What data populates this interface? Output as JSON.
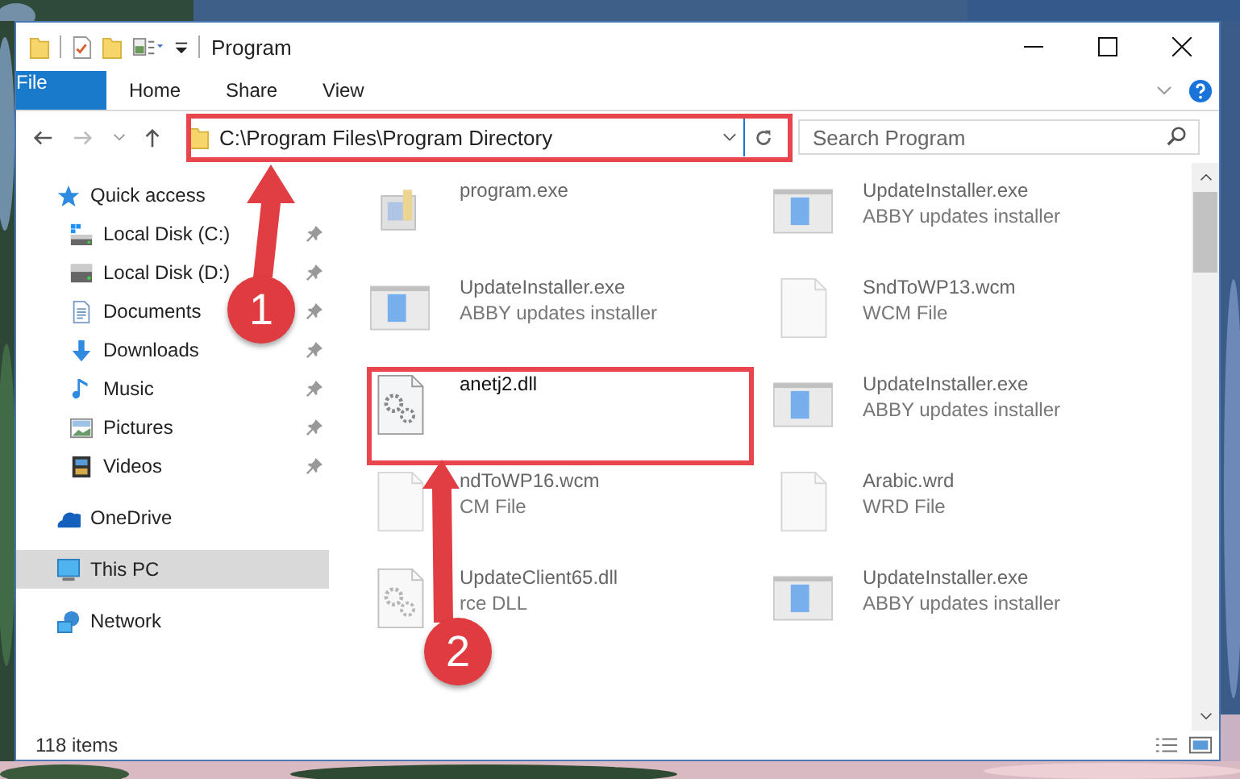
{
  "window": {
    "title": "Program"
  },
  "ribbon": {
    "tabs": [
      {
        "label": "File",
        "kind": "file",
        "selected": false
      },
      {
        "label": "Home",
        "kind": "tab",
        "selected": false
      },
      {
        "label": "Share",
        "kind": "tab",
        "selected": false
      },
      {
        "label": "View",
        "kind": "tab",
        "selected": false
      }
    ]
  },
  "address_bar": {
    "path": "C:\\Program Files\\Program Directory"
  },
  "search": {
    "placeholder": "Search Program"
  },
  "sidebar": {
    "items": [
      {
        "label": "Quick access",
        "kind": "star",
        "selected": false,
        "children": [
          {
            "label": "Local Disk (C:)",
            "kind": "system-drive",
            "pinned": true,
            "selected": false
          },
          {
            "label": "Local Disk (D:)",
            "kind": "drive",
            "pinned": true,
            "selected": false
          },
          {
            "label": "Documents",
            "kind": "documents",
            "pinned": true,
            "selected": false
          },
          {
            "label": "Downloads",
            "kind": "downloads",
            "pinned": true,
            "selected": false
          },
          {
            "label": "Music",
            "kind": "music",
            "pinned": true,
            "selected": false
          },
          {
            "label": "Pictures",
            "kind": "pictures",
            "pinned": true,
            "selected": false
          },
          {
            "label": "Videos",
            "kind": "videos",
            "pinned": true,
            "selected": false
          }
        ]
      },
      {
        "label": "OneDrive",
        "kind": "cloud",
        "selected": false
      },
      {
        "label": "This PC",
        "kind": "computer",
        "selected": true
      },
      {
        "label": "Network",
        "kind": "network",
        "selected": false
      }
    ]
  },
  "files": [
    {
      "name": "program.exe",
      "kind": "app",
      "dimmed": true
    },
    {
      "name": "UpdateInstaller.exe",
      "type": "ABBY updates installer",
      "kind": "window",
      "dimmed": true
    },
    {
      "name": "anetj2.dll",
      "kind": "gear",
      "dimmed": false
    },
    {
      "name": "ndToWP16.wcm",
      "type": "CM File",
      "kind": "blank",
      "dimmed": true
    },
    {
      "name": "UpdateClient65.dll",
      "type": "rce DLL",
      "kind": "gear",
      "dimmed": true
    },
    {
      "name": "UpdateInstaller.exe",
      "type": "ABBY updates installer",
      "kind": "window",
      "dimmed": true
    },
    {
      "name": "SndToWP13.wcm",
      "type": "WCM File",
      "kind": "blank",
      "dimmed": true
    },
    {
      "name": "UpdateInstaller.exe",
      "type": "ABBY updates installer",
      "kind": "window",
      "dimmed": true
    },
    {
      "name": "Arabic.wrd",
      "type": "WRD File",
      "kind": "blank",
      "dimmed": true
    },
    {
      "name": "UpdateInstaller.exe",
      "type": "ABBY updates installer",
      "kind": "window",
      "dimmed": true
    }
  ],
  "status_bar": {
    "item_count": "118 items"
  },
  "annotations": [
    {
      "label": "1"
    },
    {
      "label": "2"
    }
  ]
}
